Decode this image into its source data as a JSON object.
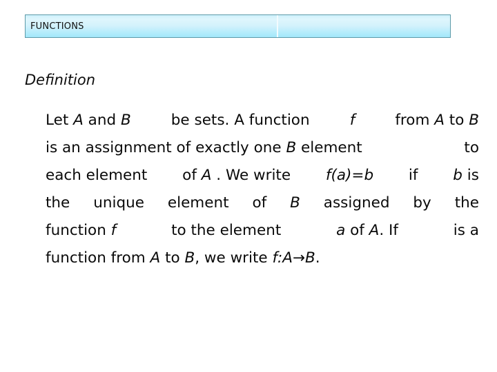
{
  "slide": {
    "title_bar": {
      "title": "FUNCTIONS",
      "right_cell_text": "",
      "border_color": "#5d9aa8",
      "fill_top_color": "#cdf1fb",
      "fill_bottom_color": "#a3e7fa",
      "divider_color": "#f3fbfe"
    },
    "heading": "Definition",
    "body": {
      "full_text": "Let A and B be sets. A function f from A to B is an assignment of exactly one B element to each element of A . We write f(a)=b if b is the unique element of B assigned by the function f to the element a of A. If is a function from A to B, we write f:A→B.",
      "lines": [
        {
          "id": "line-1",
          "align": "justify",
          "segments": [
            {
              "text": "Let ",
              "italic": false
            },
            {
              "text": "A",
              "italic": true
            },
            {
              "text": " and ",
              "italic": false
            },
            {
              "text": "B",
              "italic": true
            },
            {
              "text": "  be sets. A function ",
              "italic": false
            },
            {
              "text": "f",
              "italic": true
            },
            {
              "text": "  from ",
              "italic": false
            },
            {
              "text": "A",
              "italic": true
            },
            {
              "text": " to ",
              "italic": false
            },
            {
              "text": "B",
              "italic": true
            }
          ],
          "chunks": [
            "Let A and B",
            "be sets. A function",
            "f",
            "from A to B"
          ]
        },
        {
          "id": "line-2",
          "align": "justify",
          "segments": [
            {
              "text": "is an assignment of exactly one ",
              "italic": false
            },
            {
              "text": "B",
              "italic": true
            },
            {
              "text": " element  to",
              "italic": false
            }
          ],
          "chunks": [
            "is an assignment of exactly one B element",
            "to"
          ]
        },
        {
          "id": "line-3",
          "align": "justify",
          "segments": [
            {
              "text": "each element of ",
              "italic": false
            },
            {
              "text": "A",
              "italic": true
            },
            {
              "text": " . We write ",
              "italic": false
            },
            {
              "text": "f(a)=b",
              "italic": true
            },
            {
              "text": " if  ",
              "italic": false
            },
            {
              "text": "b",
              "italic": true
            },
            {
              "text": " is",
              "italic": false
            }
          ],
          "chunks": [
            "each element",
            "of A . We write",
            "f(a)=b",
            "if",
            "b is"
          ]
        },
        {
          "id": "line-4",
          "align": "justify",
          "segments": [
            {
              "text": "the unique element of ",
              "italic": false
            },
            {
              "text": "B",
              "italic": true
            },
            {
              "text": " assigned by the",
              "italic": false
            }
          ],
          "chunks": [
            "the",
            "unique",
            "element",
            "of",
            "B",
            "assigned",
            "by",
            "the"
          ]
        },
        {
          "id": "line-5",
          "align": "justify",
          "segments": [
            {
              "text": "function ",
              "italic": false
            },
            {
              "text": "f",
              "italic": true
            },
            {
              "text": "  to the element  ",
              "italic": false
            },
            {
              "text": "a",
              "italic": true
            },
            {
              "text": " of ",
              "italic": false
            },
            {
              "text": "A",
              "italic": true
            },
            {
              "text": ". If  is a",
              "italic": false
            }
          ],
          "chunks": [
            "function f",
            "to the element",
            "a of A. If",
            "is a"
          ]
        },
        {
          "id": "line-6",
          "align": "left",
          "segments": [
            {
              "text": "function from ",
              "italic": false
            },
            {
              "text": "A",
              "italic": true
            },
            {
              "text": " to ",
              "italic": false
            },
            {
              "text": "B",
              "italic": true
            },
            {
              "text": ", we write ",
              "italic": false
            },
            {
              "text": "f:A→B",
              "italic": true
            },
            {
              "text": ".",
              "italic": false
            }
          ],
          "chunks": [
            "function from A to B, we write f:A→B."
          ]
        }
      ]
    }
  }
}
